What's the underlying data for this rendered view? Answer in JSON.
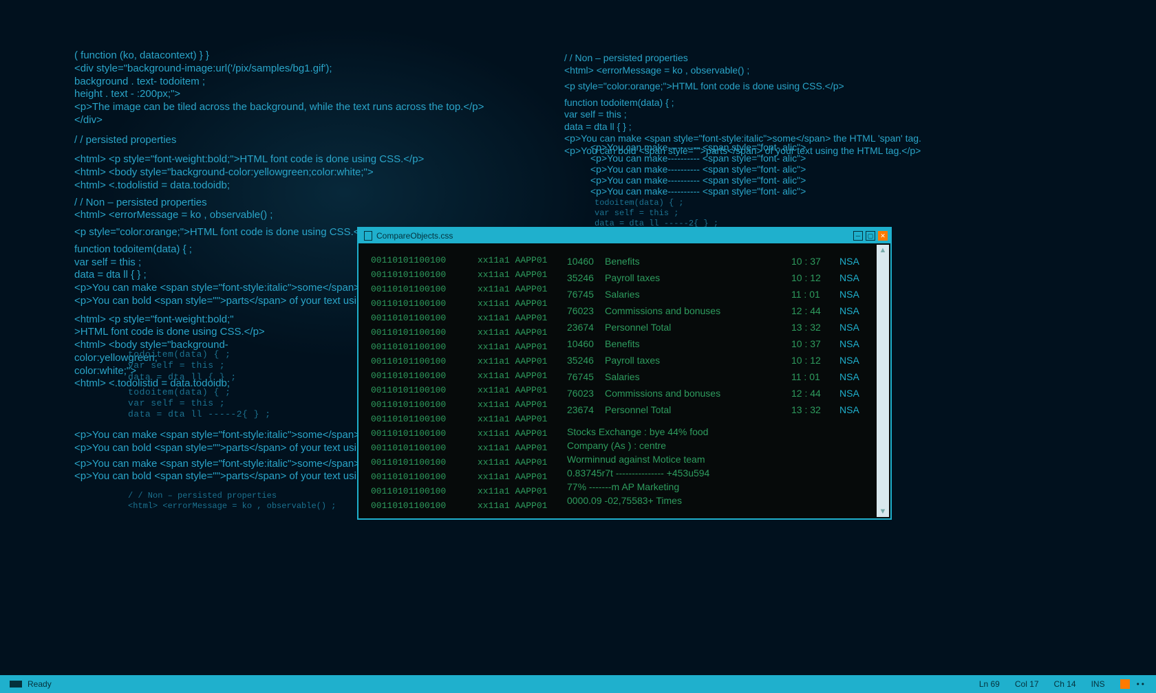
{
  "bg_left": {
    "l1": "( function  (ko, datacontext)  } }",
    "l2": " <div style=\"background-image:url('/pix/samples/bg1.gif');",
    "l3": "         background . text- todoitem ;",
    "l4": "         height . text - :200px;\">",
    "l5": "<p>The image can be tiled across the background, while the text runs across the top.</p>",
    "l6": "</div>",
    "l7": "/ /  persisted properties",
    "l8": "<html> <p style=\"font-weight:bold;\">HTML font code is done using CSS.</p>",
    "l9": "<html> <body style=\"background-color:yellowgreen;color:white;\">",
    "l10": "<html> <.todolistid = data.todoidb;",
    "l11": "  / / Non – persisted properties",
    "l12": "   <html> <errorMessage = ko , observable() ;",
    "l13": "<p style=\"color:orange;\">HTML font code is done using CSS.</p>",
    "l14": "   function  todoitem(data) { ;",
    "l15": "      var  self = this ;",
    "l16": "      data = dta  ll { } ;",
    "l17": "<p>You can make <span style=\"font-style:italic\">some</span> the H",
    "l18": "<p>You can bold <span style=\"\">parts</span> of your text using the",
    "l19": "<html> <p style=\"font-weight:bold;\"",
    "l20": ">HTML font code is done using CSS.</p>",
    "l21": "<html> <body style=\"background-",
    "l22": "color:yellowgreen;",
    "l23": "color:white;\">",
    "l24": "<html> <.todolistid = data.todoidb;",
    "m1": "todoitem(data) { ;",
    "m2": "var  self = this ;",
    "m3": "data = dta  ll { } ;",
    "m4": "todoitem(data) { ;",
    "m5": "var  self = this ;",
    "m6": "data = dta  ll -----2{ } ;",
    "b1": "<p>You can make <span style=\"font-style:italic\">some</span> the HTML 'span'",
    "b2": "<p>You can bold <span style=\"\">parts</span> of your text using the HTML tag.<",
    "b3": "<p>You can make <span style=\"font-style:italic\">some</span> the HTML 'span'",
    "b4": "<p>You can bold <span style=\"\">parts</span> of your text using the HTML tag.<",
    "f1": "/ / Non – persisted properties",
    "f2": "<html> <errorMessage = ko , observable() ;"
  },
  "bg_right": {
    "l1": "/ / Non – persisted properties",
    "l2": "  <html> <errorMessage = ko , observable() ;",
    "l3": "<p style=\"color:orange;\">HTML font code is done using CSS.</p>",
    "l4": "   function  todoitem(data) { ;",
    "l5": "      var  self = this ;",
    "l6": "      data = dta  ll { } ;",
    "l7": "<p>You can make <span style=\"font-style:italic\">some</span> the HTML 'span' tag.",
    "l8": "<p>You can bold <span style=\"\">parts</span> of your text using the HTML tag.</p>",
    "r1": "<p>You can make---------- <span style=\"font- alic\">",
    "r2": "<p>You can make---------- <span style=\"font- alic\">",
    "r3": "<p>You can make---------- <span style=\"font- alic\">",
    "r4": "<p>You can make---------- <span style=\"font- alic\">",
    "r5": "<p>You can make---------- <span style=\"font- alic\">",
    "m1": "todoitem(data) { ;",
    "m2": "var  self = this ;",
    "m3": "data = dta  ll -----2{ } ;"
  },
  "window": {
    "title": "CompareObjects.css",
    "bin_row": "00110101100100",
    "hex_col1": "xx11a1",
    "hex_col2": "AAPP01",
    "rows": [
      {
        "id": "10460",
        "desc": "Benefits",
        "time": "10 : 37",
        "tag": "NSA"
      },
      {
        "id": "35246",
        "desc": "Payroll taxes",
        "time": "10 : 12",
        "tag": "NSA"
      },
      {
        "id": "76745",
        "desc": "Salaries",
        "time": "11 : 01",
        "tag": "NSA"
      },
      {
        "id": "76023",
        "desc": "Commissions and bonuses",
        "time": "12 : 44",
        "tag": "NSA"
      },
      {
        "id": "23674",
        "desc": "Personnel Total",
        "time": "13 : 32",
        "tag": "NSA"
      },
      {
        "id": "10460",
        "desc": "Benefits",
        "time": "10 : 37",
        "tag": "NSA"
      },
      {
        "id": "35246",
        "desc": "Payroll taxes",
        "time": "10 : 12",
        "tag": "NSA"
      },
      {
        "id": "76745",
        "desc": "Salaries",
        "time": "11 : 01",
        "tag": "NSA"
      },
      {
        "id": "76023",
        "desc": "Commissions and bonuses",
        "time": "12 : 44",
        "tag": "NSA"
      },
      {
        "id": "23674",
        "desc": "Personnel Total",
        "time": "13 : 32",
        "tag": "NSA"
      }
    ],
    "extra": [
      "Stocks Exchange : bye 44% food",
      "Company (As ) : centre",
      "Worminnud  against Motice team",
      "0.83745r7t  --------------- +453u594",
      "77% -------m AP Marketing",
      "0000.09 -02,75583+ Times"
    ]
  },
  "status": {
    "ready": "Ready",
    "ln": "Ln 69",
    "col": "Col 17",
    "ch": "Ch 14",
    "ins": "INS"
  }
}
